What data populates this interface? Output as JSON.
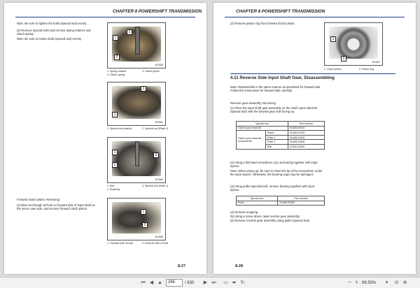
{
  "left_page": {
    "header": "CHAPTER 8 POWERSHIFT TRANSMISSION",
    "intro": {
      "note1": "Note: Be sure to tighten the bolts (special tool) evenly.",
      "step2": "(2)  Remove special tools and remove spring retainer and clutch spring.",
      "note2": "Note: Be sure to loosen bolts (special tool) evenly."
    },
    "figures": [
      {
        "code": "50G583",
        "callouts": [
          "3",
          "1",
          "2"
        ],
        "caption_a": "1.  Spring retainer",
        "caption_a2": "2.  Clutch spring",
        "caption_b": "3.  Clutch piston"
      },
      {
        "code": "50G584",
        "callouts": [
          "2",
          "1"
        ],
        "caption_a": "1.  Special tool (stand)",
        "caption_b": "2.  Special tool (Plate 2)"
      },
      {
        "code": "50G585",
        "callouts": [
          "1",
          "3",
          "2"
        ],
        "caption_a": "1.  Bolt",
        "caption_a2": "2.  Snapring",
        "caption_b": "3.  Special tool (Plate 1)"
      },
      {
        "code": "50G586",
        "callouts": [
          "1",
          "2"
        ],
        "caption_a": "1.  Forward side oil hole",
        "caption_b": "2.  Reverse side oil hole"
      }
    ],
    "forward_heading": "Forward clutch piston, Removing",
    "forward_step": "(1)  Blow air through oil hole on forward side of input shaft on the servo case side, and remove forward clutch piston.",
    "page_number": "8-27"
  },
  "right_page": {
    "header": "CHAPTER 8 POWERSHIFT TRANSMISSION",
    "step2": "(2)  Remove piston ring from forward clutch piston.",
    "figure": {
      "code": "50G587",
      "callouts": [
        "1",
        "2"
      ],
      "caption_a": "1.  Clutch piston",
      "caption_b": "2.  Piston ring"
    },
    "section_title": "4.11    Reverse Side Input Shaft Gear, Disassembling",
    "note": "Note: Disassemble in the same manner as described for forward side. Follow the instructions for forward side carefully.",
    "subheading": "Reverse gear assembly, Removing",
    "step1": "(1)  Place the input shaft gear assembly on the clutch pack stand kit (special tool) with the forward gear side facing up.",
    "table1": {
      "headers": [
        "Special tool",
        "Part number"
      ],
      "row1": [
        "Clutch pack stand kit",
        "91A68-00010"
      ],
      "group_label": "Clutch pack stand kit components",
      "rows": [
        [
          "Stand",
          "91A68-01300"
        ],
        [
          "Plate 1",
          "91A68-01400"
        ],
        [
          "Plate 2",
          "91A68-01500"
        ],
        [
          "Bolt",
          "07284-15400"
        ]
      ]
    },
    "step2b": "(2)  Using a flat head screwdriver, pry up bearing together with input spacer.",
    "note2": "Note: When prying up, be sure to insert the tip of the screwdriver under the input spacer. Otherwise, the bearing cage may be damaged.",
    "step3": "(3)  Using puller (special tool), remove bearing together with input spacer.",
    "table2": {
      "headers": [
        "Special tool",
        "Part number"
      ],
      "row": [
        "Puller",
        "91A68-01800"
      ]
    },
    "step4": "(4)  Remove snapring.",
    "step5": "(5)  Using a screw driver, raise reverse gear assembly.",
    "step6": "(6)  Remove reverse gear assembly using puller (special tool).",
    "page_number": "8-28"
  },
  "toolbar": {
    "page_current": "265",
    "page_total": "/ 630",
    "zoom": "89.93%",
    "icons": [
      "first-page-icon",
      "prev-page-icon",
      "next-page-icon",
      "last-page-icon",
      "fit-page-icon",
      "fit-width-icon",
      "zoom-out-icon",
      "zoom-in-icon"
    ]
  }
}
